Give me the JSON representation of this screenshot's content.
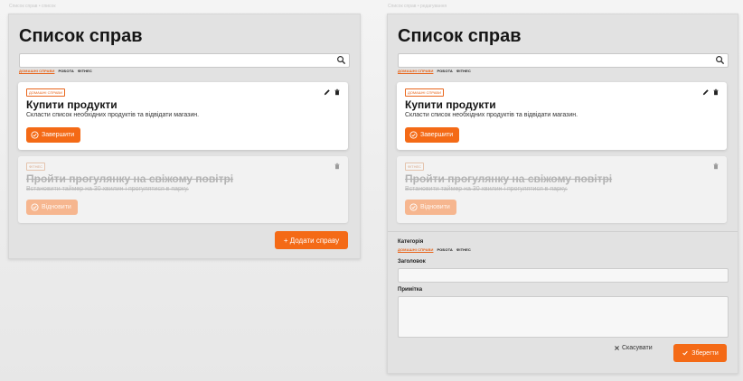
{
  "screens": [
    {
      "caption": "Список справ • список",
      "title": "Список справ",
      "search": {
        "value": "",
        "icon": "search-icon"
      },
      "filters": [
        {
          "label": "ДОМАШНІ СПРАВИ",
          "active": true
        },
        {
          "label": "РОБОТА",
          "active": false
        },
        {
          "label": "ФІТНЕС",
          "active": false
        }
      ],
      "tasks": [
        {
          "category": "ДОМАШНІ СПРАВИ",
          "title": "Купити продукти",
          "note": "Скласти список необхідних продуктів та відвідати магазин.",
          "action": "Завершити",
          "completed": false
        },
        {
          "category": "ФІТНЕС",
          "title": "Пройти прогулянку на свіжому повітрі",
          "note": "Встановити таймер на 30 хвилин і прогулятися в парку.",
          "action": "Відновити",
          "completed": true
        }
      ],
      "add_button": "+ Додати справу"
    },
    {
      "caption": "Список справ • редагування",
      "title": "Список справ",
      "search": {
        "value": "",
        "icon": "search-icon"
      },
      "filters": [
        {
          "label": "ДОМАШНІ СПРАВИ",
          "active": true
        },
        {
          "label": "РОБОТА",
          "active": false
        },
        {
          "label": "ФІТНЕС",
          "active": false
        }
      ],
      "tasks": [
        {
          "category": "ДОМАШНІ СПРАВИ",
          "title": "Купити продукти",
          "note": "Скласти список необхідних продуктів та відвідати магазин.",
          "action": "Завершити",
          "completed": false
        },
        {
          "category": "ФІТНЕС",
          "title": "Пройти прогулянку на свіжому повітрі",
          "note": "Встановити таймер на 30 хвилин і прогулятися в парку.",
          "action": "Відновити",
          "completed": true
        }
      ],
      "form": {
        "category_label": "Категорія",
        "category_options": [
          {
            "label": "ДОМАШНІ СПРАВИ",
            "active": true
          },
          {
            "label": "РОБОТА",
            "active": false
          },
          {
            "label": "ФІТНЕС",
            "active": false
          }
        ],
        "title_label": "Заголовок",
        "title_value": "",
        "note_label": "Примітка",
        "note_value": "",
        "cancel": "Скасувати",
        "save": "Зберегти"
      }
    }
  ],
  "colors": {
    "accent": "#f46a16",
    "accent_muted": "#f6b68f",
    "panel": "#e2e2e2"
  }
}
